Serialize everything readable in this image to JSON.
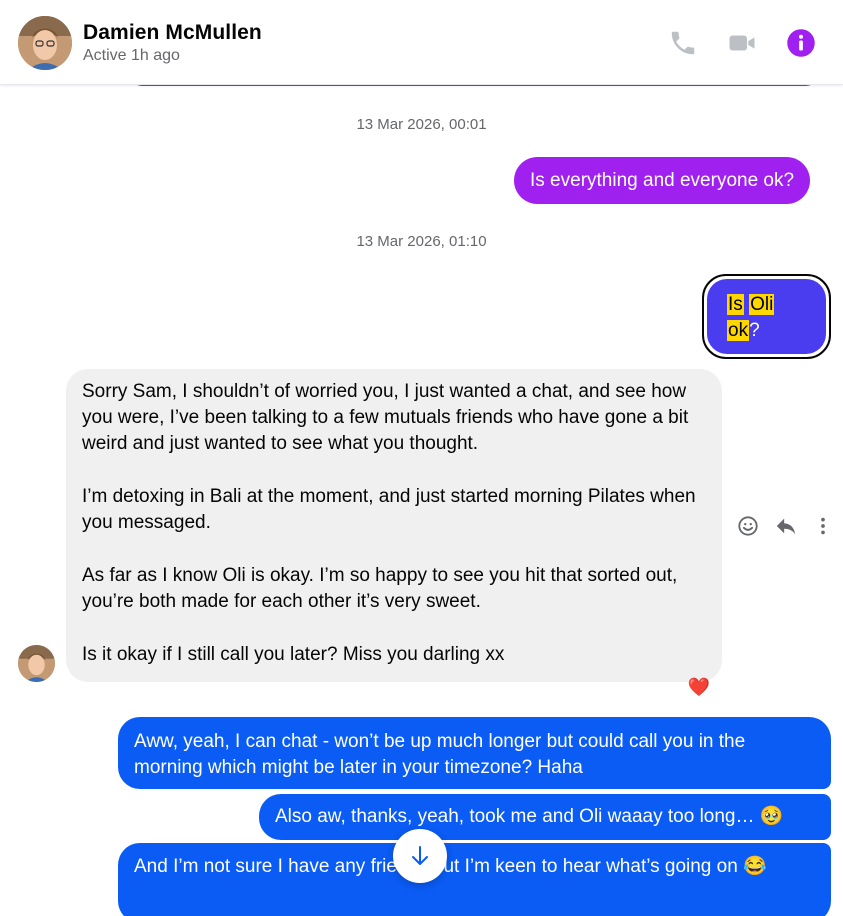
{
  "header": {
    "contact_name": "Damien McMullen",
    "status": "Active 1h ago",
    "icons": {
      "call": "phone-icon",
      "video": "video-camera-icon",
      "info": "info-icon"
    },
    "accent_color": "#a020f0"
  },
  "messages": {
    "timestamp_1": "13 Mar 2026, 00:01",
    "sent_1": "Is everything and everyone ok?",
    "timestamp_2": "13 Mar 2026, 01:10",
    "sent_2": {
      "word_1": "Is",
      "word_2": "Oli",
      "word_3": "ok",
      "punct": "?"
    },
    "received_1": {
      "para_1": "Sorry Sam, I shouldn’t  of worried you, I just wanted a chat, and see how you were, I’ve been talking to a few mutuals friends who have gone a bit weird and just wanted to see what you thought.",
      "para_2": "I’m detoxing in Bali at the moment, and just started morning Pilates when you messaged.",
      "para_3": "As far as I know Oli is okay. I’m so happy to see you hit that sorted out, you’re both made for each other it’s very sweet.",
      "para_4": "Is it okay if I still call you later? Miss you darling xx",
      "reaction": "❤️"
    },
    "sent_3": "Aww, yeah, I can chat - won’t be up much longer but could call you in the morning which might be later in your timezone? Haha",
    "sent_4": "Also aw, thanks, yeah, took me and Oli waaay too long… 🥹",
    "sent_5": "And I’m not sure I have any friends but I’m keen to hear what’s going on 😂"
  },
  "message_actions": [
    "smiley-icon",
    "reply-icon",
    "more-vertical-icon"
  ],
  "colors": {
    "sent_blue": "#0a5cf5",
    "sent_purple": "#a020f0",
    "selected_bubble": "#4a3df0",
    "highlight": "#ffd700",
    "received_grey": "#f0f0f0"
  }
}
